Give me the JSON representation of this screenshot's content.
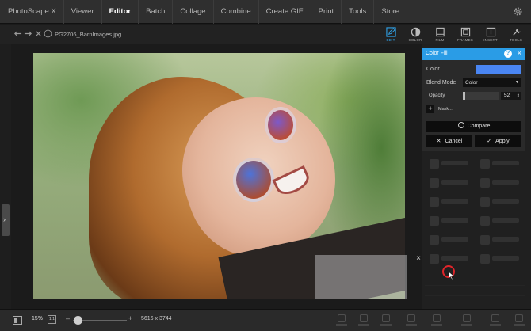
{
  "menu": {
    "items": [
      "PhotoScape X",
      "Viewer",
      "Editor",
      "Batch",
      "Collage",
      "Combine",
      "Create GIF",
      "Print",
      "Tools",
      "Store"
    ],
    "active": "Editor"
  },
  "toolbar": {
    "filename": "PG2706_BarnImages.jpg",
    "tabs": [
      {
        "label": "EDIT",
        "icon": "edit-icon",
        "active": true
      },
      {
        "label": "COLOR",
        "icon": "color-icon"
      },
      {
        "label": "FILM",
        "icon": "film-icon"
      },
      {
        "label": "FRAMES",
        "icon": "frames-icon"
      },
      {
        "label": "INSERT",
        "icon": "insert-icon"
      },
      {
        "label": "TOOLS",
        "icon": "tools-icon"
      }
    ]
  },
  "color_fill": {
    "title": "Color Fill",
    "help": "?",
    "close": "×",
    "color_label": "Color",
    "color_value": "#4a86f3",
    "blend_label": "Blend Mode",
    "blend_value": "Color",
    "opacity_label": "Opacity",
    "opacity_value": "52",
    "mask_label": "Mask...",
    "compare_label": "Compare",
    "cancel_label": "Cancel",
    "apply_label": "Apply"
  },
  "canvas": {
    "close_overlay": "×"
  },
  "bottom": {
    "zoom": "15%",
    "one_to_one": "1:1",
    "zoom_minus": "–",
    "zoom_plus": "+",
    "dimensions": "5616 x 3744"
  },
  "colors": {
    "accent": "#2a9ce6",
    "menu_bg": "#2f2f2f",
    "panel_bg": "#2a2a2a"
  }
}
